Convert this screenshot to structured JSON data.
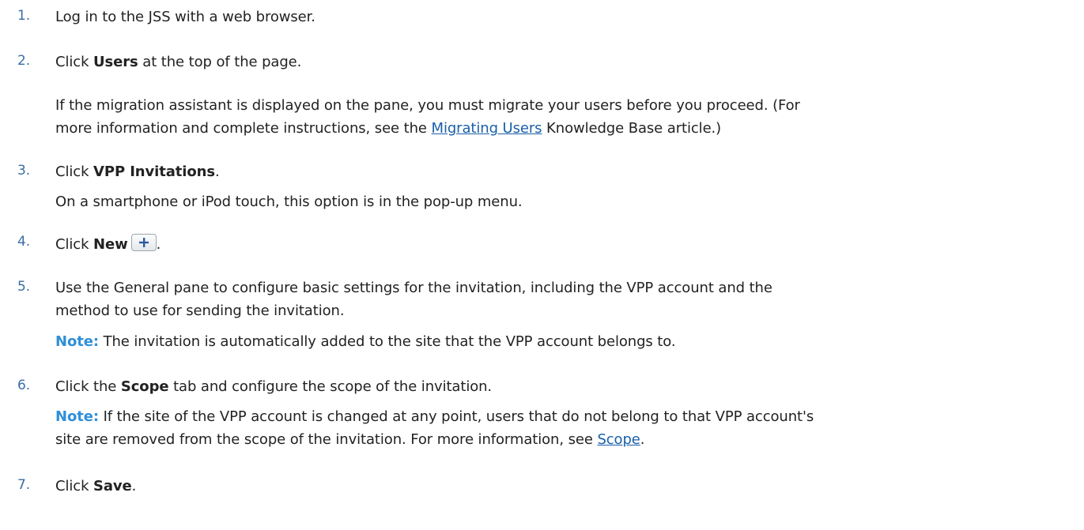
{
  "steps": [
    {
      "number": "1.",
      "text": "Log in to the JSS with a web browser."
    },
    {
      "number": "2.",
      "pre": "Click ",
      "bold": "Users",
      "post": " at the top of the page.",
      "para1": "If the migration assistant is displayed on the pane, you must migrate your users before you proceed. (For",
      "para2_pre": "more information and complete instructions, see the ",
      "para2_link": "Migrating Users",
      "para2_post": " Knowledge Base article.)"
    },
    {
      "number": "3.",
      "pre": "Click ",
      "bold": "VPP Invitations",
      "post": ".",
      "para": "On a smartphone or iPod touch, this option is in the pop-up menu."
    },
    {
      "number": "4.",
      "pre": "Click ",
      "bold": "New",
      "post": ".",
      "button_icon": "plus-icon"
    },
    {
      "number": "5.",
      "line1": "Use the General pane to configure basic settings for the invitation, including the VPP account and the",
      "line2": "method to use for sending the invitation.",
      "note_label": "Note:",
      "note_text": " The invitation is automatically added to the site that the VPP account belongs to."
    },
    {
      "number": "6.",
      "pre": "Click the ",
      "bold": "Scope",
      "post": " tab and configure the scope of the invitation.",
      "note_label": "Note:",
      "note_line1": " If the site of the VPP account is changed at any point, users that do not belong to that VPP account's",
      "note_line2_pre": "site are removed from the scope of the invitation. For more information, see ",
      "note_line2_link": "Scope",
      "note_line2_post": "."
    },
    {
      "number": "7.",
      "pre": "Click ",
      "bold": "Save",
      "post": "."
    }
  ],
  "colors": {
    "number": "#3a6ea5",
    "note": "#2f8fd8",
    "link": "#1a5fa8",
    "text": "#222222"
  }
}
